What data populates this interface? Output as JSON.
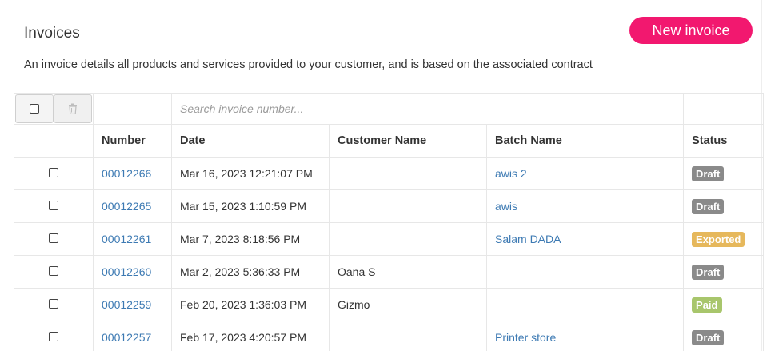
{
  "header": {
    "title": "Invoices",
    "new_invoice_label": "New invoice",
    "description": "An invoice details all products and services provided to your customer, and is based on the associated contract"
  },
  "toolbar": {
    "search_placeholder": "Search invoice number..."
  },
  "columns": {
    "number": "Number",
    "date": "Date",
    "customer": "Customer Name",
    "batch": "Batch Name",
    "status": "Status"
  },
  "rows": [
    {
      "number": "00012266",
      "date": "Mar 16, 2023 12:21:07 PM",
      "customer": "",
      "batch": "awis 2",
      "status": "Draft"
    },
    {
      "number": "00012265",
      "date": "Mar 15, 2023 1:10:59 PM",
      "customer": "",
      "batch": "awis",
      "status": "Draft"
    },
    {
      "number": "00012261",
      "date": "Mar 7, 2023 8:18:56 PM",
      "customer": "",
      "batch": "Salam DADA",
      "status": "Exported"
    },
    {
      "number": "00012260",
      "date": "Mar 2, 2023 5:36:33 PM",
      "customer": "Oana S",
      "batch": "",
      "status": "Draft"
    },
    {
      "number": "00012259",
      "date": "Feb 20, 2023 1:36:03 PM",
      "customer": "Gizmo",
      "batch": "",
      "status": "Paid"
    },
    {
      "number": "00012257",
      "date": "Feb 17, 2023 4:20:57 PM",
      "customer": "",
      "batch": "Printer store",
      "status": "Draft"
    }
  ],
  "colors": {
    "primary_button": "#f2186f",
    "link": "#3d7ab3",
    "status_draft": "#8a8a8a",
    "status_exported": "#e6b85c",
    "status_paid": "#a8c66c"
  },
  "icons": {
    "trash": "trash-icon",
    "checkbox": "checkbox-icon"
  }
}
